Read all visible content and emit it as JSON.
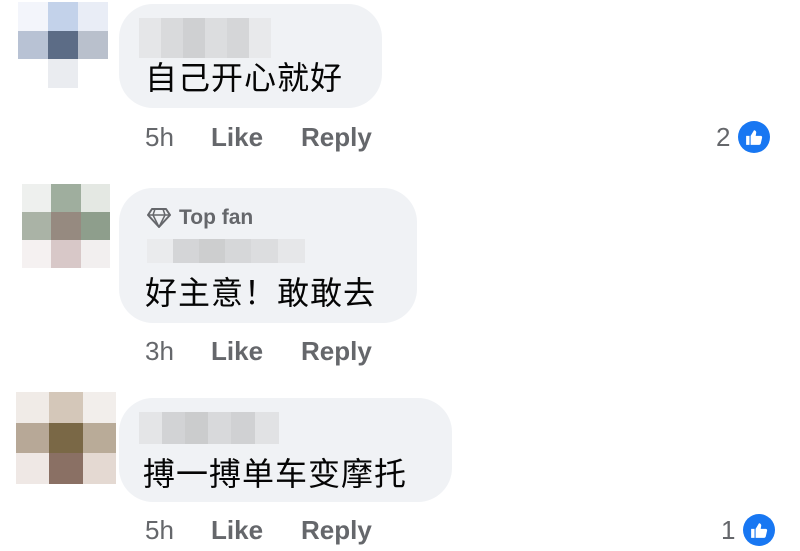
{
  "comments": [
    {
      "text": "自己开心就好",
      "time": "5h",
      "like_label": "Like",
      "reply_label": "Reply",
      "reaction_count": "2"
    },
    {
      "badge": "Top fan",
      "text": "好主意！敢敢去",
      "time": "3h",
      "like_label": "Like",
      "reply_label": "Reply"
    },
    {
      "text": "搏一搏单车变摩托",
      "time": "5h",
      "like_label": "Like",
      "reply_label": "Reply",
      "reaction_count": "1"
    }
  ],
  "colors": {
    "bubble": "#f0f2f5",
    "secondary_text": "#65676b",
    "like_blue": "#1877f2"
  },
  "icons": {
    "badge": "diamond-icon",
    "reaction": "thumbs-up-icon"
  }
}
